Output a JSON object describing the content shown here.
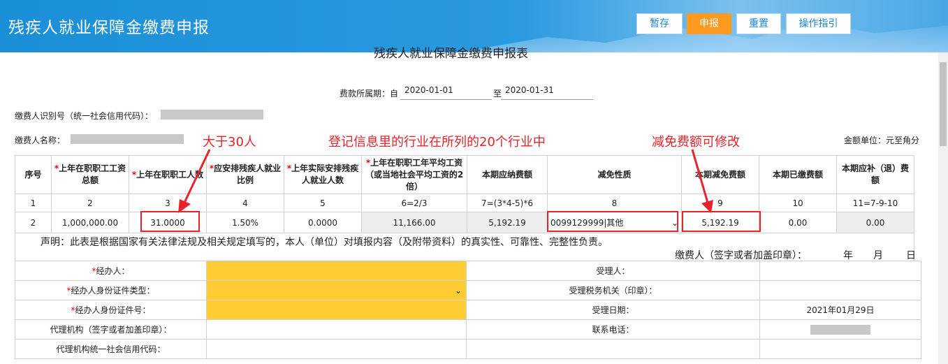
{
  "header": {
    "title": "残疾人就业保障金缴费申报",
    "buttons": {
      "save": "暂存",
      "submit": "申报",
      "reset": "重置",
      "guide": "操作指引"
    }
  },
  "form": {
    "subtitle": "残疾人就业保障金缴费申报表",
    "period_label": "费款所属期：自",
    "period_from": "2020-01-01",
    "period_to_label": "至",
    "period_to": "2020-01-31",
    "payer_id_label": "缴费人识别号（统一社会信用代码）：",
    "payer_name_label": "缴费人名称：",
    "unit_label": "金额单位：元至角分"
  },
  "annotations": {
    "a1": "大于30人",
    "a2": "登记信息里的行业在所列的20个行业中",
    "a3": "减免费额可修改"
  },
  "table": {
    "headers": [
      {
        "req": "",
        "text": "序号"
      },
      {
        "req": "*",
        "text": "上年在职职工工资总额"
      },
      {
        "req": "*",
        "text": "上年在职职工人数"
      },
      {
        "req": "*",
        "text": "应安排残疾人就业比例"
      },
      {
        "req": "*",
        "text": "上年实际安排残疾人就业人数"
      },
      {
        "req": "*",
        "text": "上年在职职工年平均工资（或当地社会平均工资的2倍）"
      },
      {
        "req": "",
        "text": "本期应纳费额"
      },
      {
        "req": "",
        "text": "减免性质"
      },
      {
        "req": "",
        "text": "本期减免费额"
      },
      {
        "req": "",
        "text": "本期已缴费额"
      },
      {
        "req": "",
        "text": "本期应补（退）费额"
      }
    ],
    "index_row": [
      "1",
      "2",
      "3",
      "4",
      "5",
      "6=2/3",
      "7=(3*4-5)*6",
      "8",
      "9",
      "10",
      "11=7-9-10"
    ],
    "data_row": {
      "seq": "2",
      "total_salary": "1,000,000.00",
      "staff_count": "31.0000",
      "ratio": "1.50%",
      "actual_disabled": "0.0000",
      "avg_salary": "11,166.00",
      "payable": "5,192.19",
      "relief_nature": "0099129999|其他",
      "relief_amount": "5,192.19",
      "paid": "0.00",
      "due": "0.00"
    },
    "declaration": "声明：此表是根据国家有关法律法规及相关规定填写的，本人（单位）对填报内容（及附带资料）的真实性、可靠性、完整性负责。",
    "sign_label": "缴费人（签字或者加盖印章）：",
    "year": "年",
    "month": "月",
    "day": "日"
  },
  "bottom": {
    "agent_label": "经办人：",
    "id_type_label": "经办人身份证件类型：",
    "id_no_label": "经办人身份证件号：",
    "agency_label": "代理机构（签字或者加盖印章）：",
    "agency_code_label": "代理机构统一社会信用代码：",
    "receiver_label": "受理人：",
    "tax_office_label": "受理税务机关（印章）：",
    "date_label": "受理日期：",
    "date_value": "2021年01月29日",
    "phone_label": "联系电话："
  },
  "colors": {
    "accent": "#1e86d1",
    "orange": "#ff9a1f",
    "annotation": "#e8232a",
    "required_field": "#ffcc33"
  }
}
